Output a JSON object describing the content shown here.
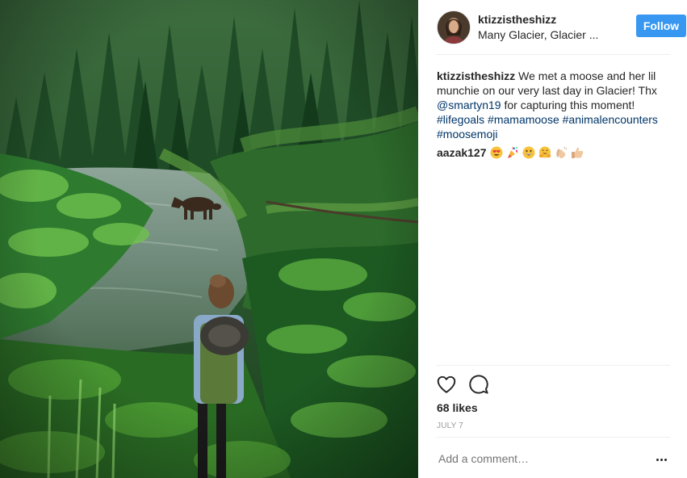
{
  "post": {
    "username": "ktizzistheshizz",
    "location": "Many Glacier, Glacier ...",
    "follow_label": "Follow",
    "caption": {
      "username": "ktizzistheshizz",
      "text_1": "We met a moose and her lil munchie on our very last day in Glacier! Thx",
      "mention": "@smartyn19",
      "text_2": "for capturing this moment!",
      "hashtags": [
        "#lifegoals",
        "#mamamoose",
        "#animalencounters",
        "#moosemoji"
      ]
    },
    "comments": [
      {
        "username": "aazak127",
        "emojis": [
          "heart-eyes-emoji",
          "party-popper-emoji",
          "grinning-emoji",
          "hugging-emoji",
          "clapping-emoji",
          "thumbs-up-emoji"
        ]
      }
    ],
    "likes": "68 likes",
    "date": "JULY 7",
    "comment_placeholder": "Add a comment…"
  },
  "colors": {
    "accent": "#3897f0",
    "link": "#003569",
    "muted": "#999999",
    "text": "#262626"
  }
}
